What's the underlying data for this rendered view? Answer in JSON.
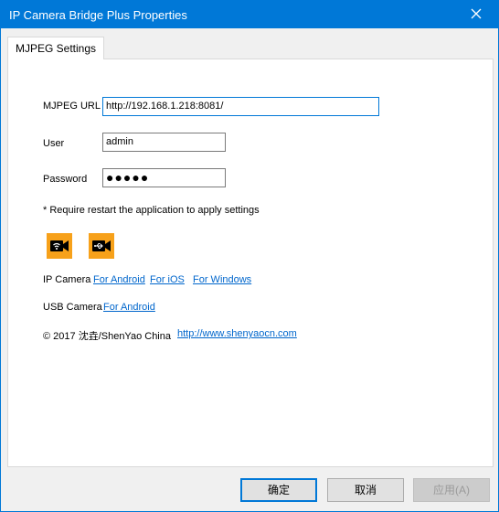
{
  "window": {
    "title": "IP Camera Bridge Plus Properties",
    "accent_color": "#0078d7"
  },
  "tabs": [
    {
      "label": "MJPEG Settings",
      "selected": true
    }
  ],
  "form": {
    "url_label": "MJPEG URL",
    "url_value": "http://192.168.1.218:8081/",
    "user_label": "User",
    "user_value": "admin",
    "password_label": "Password",
    "password_mask": "●●●●●",
    "restart_note": "* Require restart the application to apply settings"
  },
  "icons": {
    "wifi_camera": "wifi-camera-icon",
    "usb_camera": "usb-camera-icon",
    "badge_color": "#f7a11a"
  },
  "ip_camera": {
    "label": "IP Camera",
    "links": [
      "For Android",
      "For iOS",
      "For Windows"
    ]
  },
  "usb_camera": {
    "label": "USB Camera",
    "links": [
      "For Android"
    ]
  },
  "footer": {
    "copyright": "© 2017 沈垚/ShenYao China",
    "website": "http://www.shenyaocn.com"
  },
  "buttons": {
    "ok": "确定",
    "cancel": "取消",
    "apply": "应用(A)"
  }
}
